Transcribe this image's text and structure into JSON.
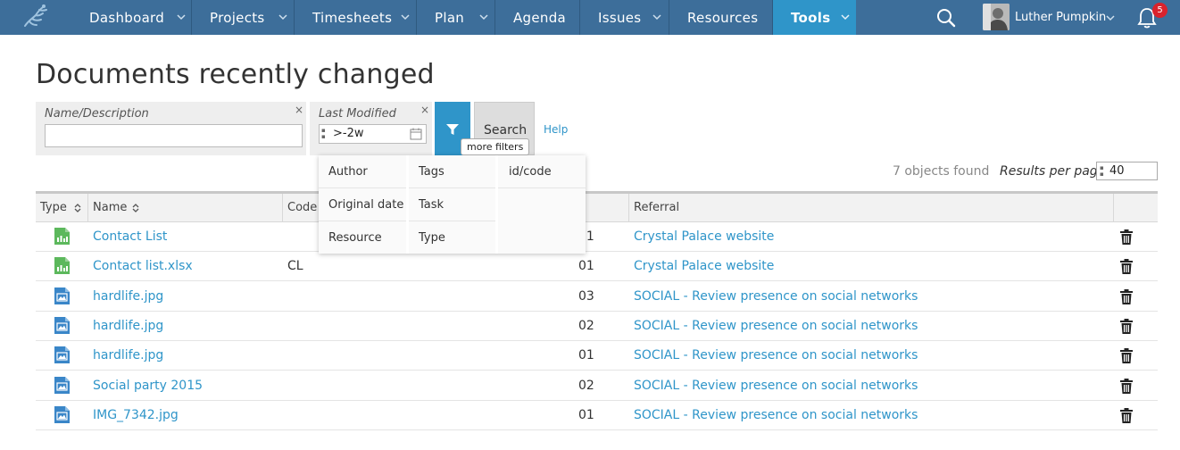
{
  "nav": {
    "items": [
      {
        "label": "Dashboard",
        "has_menu": true,
        "active": false
      },
      {
        "label": "Projects",
        "has_menu": true,
        "active": false
      },
      {
        "label": "Timesheets",
        "has_menu": true,
        "active": false
      },
      {
        "label": "Plan",
        "has_menu": true,
        "active": false
      },
      {
        "label": "Agenda",
        "has_menu": false,
        "active": false
      },
      {
        "label": "Issues",
        "has_menu": true,
        "active": false
      },
      {
        "label": "Resources",
        "has_menu": false,
        "active": false
      },
      {
        "label": "Tools",
        "has_menu": true,
        "active": true
      }
    ],
    "user_name": "Luther Pumpkin",
    "notification_count": "5"
  },
  "page": {
    "title": "Documents recently changed"
  },
  "filters": {
    "name_label": "Name/Description",
    "name_value": "",
    "modified_label": "Last Modified",
    "modified_value": ">-2w",
    "clear_symbol": "×",
    "search_label": "Search",
    "help_label": "Help",
    "more_filters_tooltip": "more filters"
  },
  "more_filters": {
    "col1": [
      "Author",
      "Original date",
      "Resource"
    ],
    "col2": [
      "Tags",
      "Task",
      "Type"
    ],
    "col3": [
      "id/code"
    ]
  },
  "results": {
    "count_text": "7 objects found",
    "per_page_label": "Results per page",
    "per_page_value": "40"
  },
  "table": {
    "headers": {
      "type": "Type",
      "name": "Name",
      "code": "Code",
      "referral": "Referral"
    },
    "rows": [
      {
        "icon": "spreadsheet-icon",
        "name": "Contact List",
        "code": "",
        "version": "01",
        "referral": "Crystal Palace website"
      },
      {
        "icon": "spreadsheet-icon",
        "name": "Contact list.xlsx",
        "code": "CL",
        "version": "01",
        "referral": "Crystal Palace website"
      },
      {
        "icon": "image-icon",
        "name": "hardlife.jpg",
        "code": "",
        "version": "03",
        "referral": "SOCIAL - Review presence on social networks"
      },
      {
        "icon": "image-icon",
        "name": "hardlife.jpg",
        "code": "",
        "version": "02",
        "referral": "SOCIAL - Review presence on social networks"
      },
      {
        "icon": "image-icon",
        "name": "hardlife.jpg",
        "code": "",
        "version": "01",
        "referral": "SOCIAL - Review presence on social networks"
      },
      {
        "icon": "image-icon",
        "name": "Social party 2015",
        "code": "",
        "version": "02",
        "referral": "SOCIAL - Review presence on social networks"
      },
      {
        "icon": "image-icon",
        "name": "IMG_7342.jpg",
        "code": "",
        "version": "01",
        "referral": "SOCIAL - Review presence on social networks"
      }
    ]
  },
  "colors": {
    "nav_bg": "#3d6e9a",
    "nav_active": "#2f95c9",
    "link": "#2f95c9",
    "badge": "#d9232d"
  }
}
